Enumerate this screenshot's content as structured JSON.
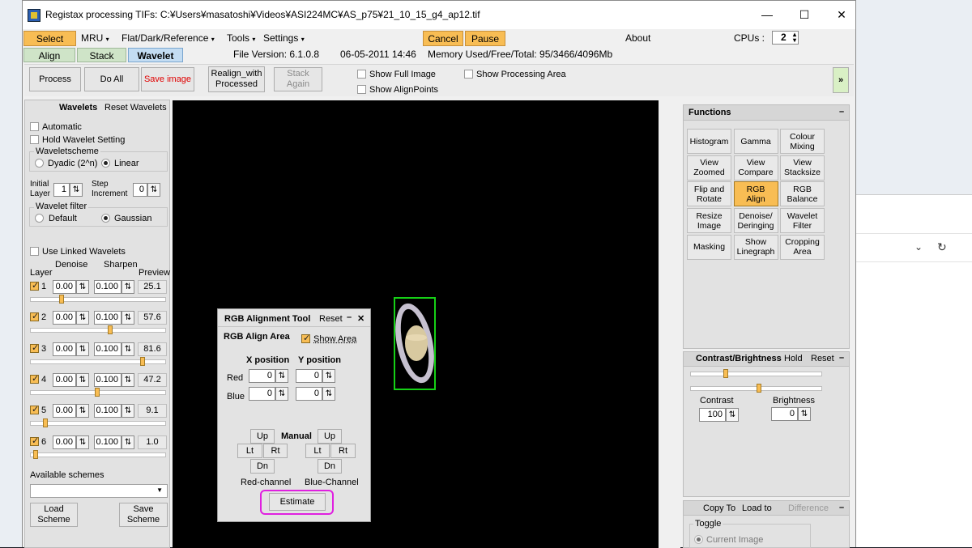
{
  "window": {
    "title": "Registax processing TIFs: C:¥Users¥masatoshi¥Videos¥ASI224MC¥AS_p75¥21_10_15_g4_ap12.tif",
    "minimize": "—",
    "maximize": "☐",
    "close": "✕"
  },
  "menu": {
    "select": "Select",
    "mru": "MRU",
    "flat": "Flat/Dark/Reference",
    "tools": "Tools",
    "settings": "Settings",
    "cancel": "Cancel",
    "pause": "Pause",
    "about": "About",
    "cpus_label": "CPUs :",
    "cpus_value": "2"
  },
  "tabs": {
    "align": "Align",
    "stack": "Stack",
    "wavelet": "Wavelet"
  },
  "info": {
    "file_version": "File Version: 6.1.0.8",
    "date": "06-05-2011 14:46",
    "memory": "Memory Used/Free/Total: 95/3466/4096Mb"
  },
  "toolbar": {
    "process": "Process",
    "do_all": "Do All",
    "save_image": "Save image",
    "realign_1": "Realign_with",
    "realign_2": "Processed",
    "stack_again": "Stack Again",
    "show_full": "Show Full Image",
    "show_align": "Show AlignPoints",
    "show_processing": "Show Processing Area",
    "expand": "»"
  },
  "wavelets": {
    "title": "Wavelets",
    "reset": "Reset Wavelets",
    "automatic": "Automatic",
    "hold": "Hold Wavelet Setting",
    "scheme_label": "Waveletscheme",
    "dyadic": "Dyadic (2^n)",
    "linear": "Linear",
    "initial1": "Initial",
    "initial2": "Layer",
    "initial_value": "1",
    "step1": "Step",
    "step2": "Increment",
    "step_value": "0",
    "filter_label": "Wavelet filter",
    "default": "Default",
    "gaussian": "Gaussian",
    "linked": "Use Linked Wavelets",
    "col_layer": "Layer",
    "col_denoise": "Denoise",
    "col_sharpen": "Sharpen",
    "col_preview": "Preview",
    "layers": [
      {
        "n": "1",
        "denoise": "0.00",
        "sharpen": "0.100",
        "preview": "25.1",
        "level": 0.21
      },
      {
        "n": "2",
        "denoise": "0.00",
        "sharpen": "0.100",
        "preview": "57.6",
        "level": 0.59
      },
      {
        "n": "3",
        "denoise": "0.00",
        "sharpen": "0.100",
        "preview": "81.6",
        "level": 0.84
      },
      {
        "n": "4",
        "denoise": "0.00",
        "sharpen": "0.100",
        "preview": "47.2",
        "level": 0.49
      },
      {
        "n": "5",
        "denoise": "0.00",
        "sharpen": "0.100",
        "preview": "9.1",
        "level": 0.09
      },
      {
        "n": "6",
        "denoise": "0.00",
        "sharpen": "0.100",
        "preview": "1.0",
        "level": 0.01
      }
    ],
    "available": "Available schemes",
    "load1": "Load",
    "load2": "Scheme",
    "save1": "Save",
    "save2": "Scheme"
  },
  "rgb_tool": {
    "title": "RGB Alignment Tool",
    "reset": "Reset",
    "minimize": "–",
    "close": "✕",
    "area_label": "RGB Align Area",
    "show_area": "Show Area",
    "x_pos": "X position",
    "y_pos": "Y position",
    "red": "Red",
    "blue": "Blue",
    "red_x": "0",
    "red_y": "0",
    "blue_x": "0",
    "blue_y": "0",
    "up": "Up",
    "lt": "Lt",
    "rt": "Rt",
    "dn": "Dn",
    "manual": "Manual",
    "red_channel": "Red-channel",
    "blue_channel": "Blue-Channel",
    "estimate": "Estimate"
  },
  "functions": {
    "title": "Functions",
    "collapse": "–",
    "buttons": [
      [
        "Histogram"
      ],
      [
        "Gamma"
      ],
      [
        "Colour",
        "Mixing"
      ],
      [
        "View",
        "Zoomed"
      ],
      [
        "View",
        "Compare"
      ],
      [
        "View",
        "Stacksize"
      ],
      [
        "Flip and",
        "Rotate"
      ],
      [
        "RGB",
        "Align"
      ],
      [
        "RGB",
        "Balance"
      ],
      [
        "Resize",
        "Image"
      ],
      [
        "Denoise/",
        "Deringing"
      ],
      [
        "Wavelet",
        "Filter"
      ],
      [
        "Masking"
      ],
      [
        "Show",
        "Linegraph"
      ],
      [
        "Cropping",
        "Area"
      ]
    ]
  },
  "contrast": {
    "title": "Contrast/Brightness",
    "hold": "Hold",
    "reset": "Reset",
    "collapse": "–",
    "contrast_label": "Contrast",
    "brightness_label": "Brightness",
    "contrast_value": "100",
    "brightness_value": "0",
    "slider1_level": 0.25,
    "slider2_level": 0.5
  },
  "copy": {
    "copy_to": "Copy To",
    "load_to": "Load to",
    "difference": "Difference",
    "collapse": "–",
    "toggle": "Toggle",
    "current": "Current Image"
  },
  "colors": {
    "accent": "#f8bd54",
    "selection": "#e020e0",
    "align_box": "#16d016"
  }
}
